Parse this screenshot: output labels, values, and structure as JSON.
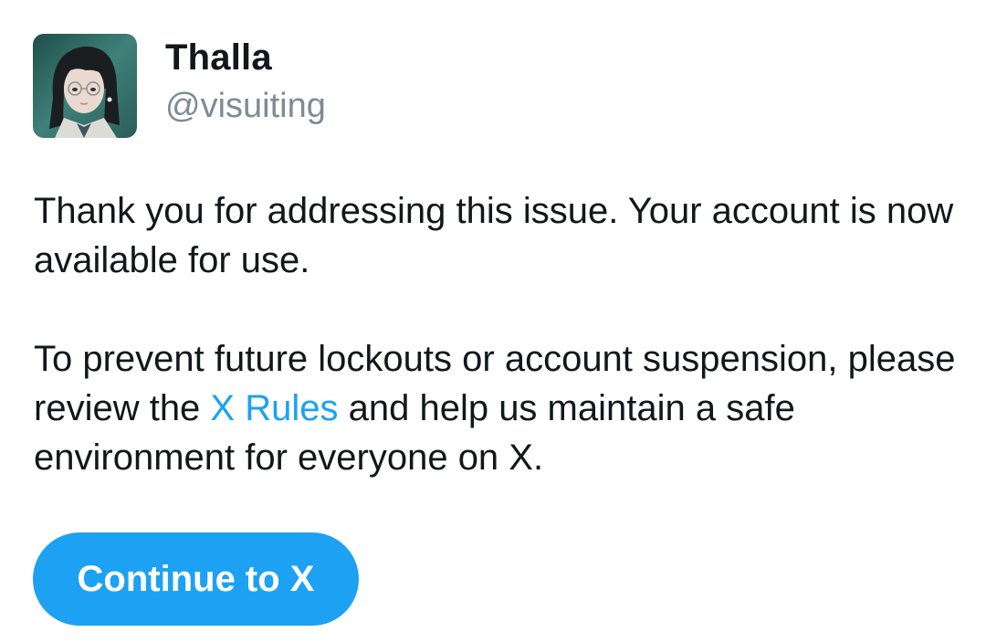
{
  "profile": {
    "display_name": "Thalla",
    "handle": "@visuiting",
    "avatar": "profile-photo"
  },
  "message": {
    "paragraph1": "Thank you for addressing this issue. Your account is now available for use.",
    "paragraph2_before": "To prevent future lockouts or account suspension, please review the ",
    "paragraph2_link": "X Rules",
    "paragraph2_after": " and help us maintain a safe environment for everyone on X."
  },
  "actions": {
    "continue_label": "Continue to X"
  },
  "colors": {
    "accent": "#1da1f2",
    "text": "#14171a",
    "secondary_text": "#7d8b96",
    "background": "#ffffff"
  }
}
